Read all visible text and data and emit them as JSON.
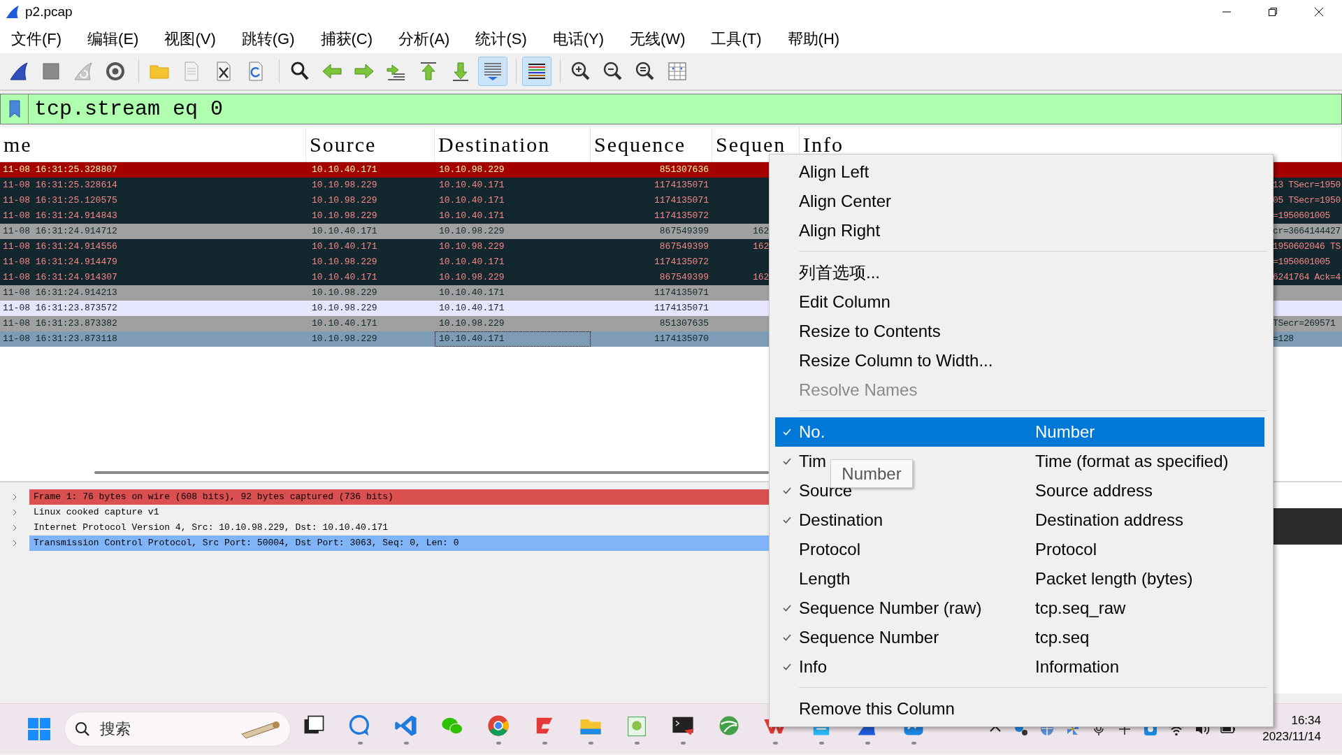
{
  "window": {
    "title": "p2.pcap"
  },
  "menu_bar": [
    "文件(F)",
    "编辑(E)",
    "视图(V)",
    "跳转(G)",
    "捕获(C)",
    "分析(A)",
    "统计(S)",
    "电话(Y)",
    "无线(W)",
    "工具(T)",
    "帮助(H)"
  ],
  "toolbar": [
    [
      {
        "kind": "start",
        "on": false
      },
      {
        "kind": "stop",
        "on": false
      },
      {
        "kind": "restart",
        "on": false
      },
      {
        "kind": "options",
        "on": false
      }
    ],
    [
      {
        "kind": "open",
        "on": false
      },
      {
        "kind": "save",
        "on": false
      },
      {
        "kind": "close",
        "on": false
      },
      {
        "kind": "reload",
        "on": false
      }
    ],
    [
      {
        "kind": "find",
        "on": false
      },
      {
        "kind": "back",
        "on": false
      },
      {
        "kind": "forward",
        "on": false
      },
      {
        "kind": "goto",
        "on": false
      },
      {
        "kind": "first",
        "on": false
      },
      {
        "kind": "last",
        "on": false
      },
      {
        "kind": "autoscroll",
        "on": true
      }
    ],
    [
      {
        "kind": "colorize",
        "on": true
      }
    ],
    [
      {
        "kind": "zoomin",
        "on": false
      },
      {
        "kind": "zoomout",
        "on": false
      },
      {
        "kind": "zoomreset",
        "on": false
      },
      {
        "kind": "resize",
        "on": false
      }
    ]
  ],
  "filter": {
    "value": "tcp.stream eq 0"
  },
  "packet_list": {
    "columns": [
      "me",
      "Source",
      "Destination",
      "Sequence",
      "Sequen",
      "Info"
    ],
    "rows": [
      {
        "kind": "error",
        "selected": false,
        "time": "11-08 16:31:25.328807",
        "source": "10.10.40.171",
        "destination": "10.10.98.229",
        "sequence": "851307636"
      },
      {
        "kind": "bad",
        "selected": false,
        "time": "11-08 16:31:25.328614",
        "source": "10.10.98.229",
        "destination": "10.10.40.171",
        "sequence": "1174135071",
        "info": "13 TSecr=1950"
      },
      {
        "kind": "bad",
        "selected": false,
        "time": "11-08 16:31:25.120575",
        "source": "10.10.98.229",
        "destination": "10.10.40.171",
        "sequence": "1174135071",
        "info": "05 TSecr=1950"
      },
      {
        "kind": "bad",
        "selected": false,
        "time": "11-08 16:31:24.914843",
        "source": "10.10.98.229",
        "destination": "10.10.40.171",
        "sequence": "1174135072",
        "info": "=1950601005"
      },
      {
        "kind": "gray",
        "selected": false,
        "time": "11-08 16:31:24.914712",
        "source": "10.10.40.171",
        "destination": "10.10.98.229",
        "sequence": "867549399",
        "column_5": "162",
        "info": "cr=3664144427"
      },
      {
        "kind": "bad",
        "selected": false,
        "time": "11-08 16:31:24.914556",
        "source": "10.10.40.171",
        "destination": "10.10.98.229",
        "sequence": "867549399",
        "column_5": "162",
        "info": "1950602046 TS"
      },
      {
        "kind": "bad",
        "selected": false,
        "time": "11-08 16:31:24.914479",
        "source": "10.10.98.229",
        "destination": "10.10.40.171",
        "sequence": "1174135072",
        "info": "=1950601005"
      },
      {
        "kind": "bad",
        "selected": false,
        "time": "11-08 16:31:24.914307",
        "source": "10.10.40.171",
        "destination": "10.10.98.229",
        "sequence": "867549399",
        "column_5": "162",
        "info": "6241764 Ack=4"
      },
      {
        "kind": "gray",
        "selected": false,
        "time": "11-08 16:31:24.914213",
        "source": "10.10.98.229",
        "destination": "10.10.40.171",
        "sequence": "1174135071"
      },
      {
        "kind": "tcp",
        "selected": false,
        "time": "11-08 16:31:23.873572",
        "source": "10.10.98.229",
        "destination": "10.10.40.171",
        "sequence": "1174135071"
      },
      {
        "kind": "gray",
        "selected": false,
        "time": "11-08 16:31:23.873382",
        "source": "10.10.40.171",
        "destination": "10.10.98.229",
        "sequence": "851307635",
        "info": "TSecr=269571"
      },
      {
        "kind": "tcp",
        "selected": true,
        "time": "11-08 16:31:23.873118",
        "source": "10.10.98.229",
        "destination": "10.10.40.171",
        "sequence": "1174135070",
        "info": "=128"
      }
    ]
  },
  "packet_details": [
    {
      "kind": "error",
      "selected": false,
      "expanded": false,
      "text": "Frame 1: 76 bytes on wire (608 bits), 92 bytes captured (736 bits)"
    },
    {
      "kind": "plain",
      "selected": false,
      "expanded": false,
      "text": "Linux cooked capture v1"
    },
    {
      "kind": "plain",
      "selected": false,
      "expanded": false,
      "text": "Internet Protocol Version 4, Src: 10.10.98.229, Dst: 10.10.40.171"
    },
    {
      "kind": "plain",
      "selected": true,
      "expanded": false,
      "text": "Transmission Control Protocol, Src Port: 50004, Dst Port: 3063, Seq: 0, Len: 0"
    }
  ],
  "context_menu": {
    "items": [
      {
        "kind": "action",
        "label": "Align Left",
        "disabled": false,
        "selected": false
      },
      {
        "kind": "action",
        "label": "Align Center",
        "disabled": false,
        "selected": false
      },
      {
        "kind": "action",
        "label": "Align Right",
        "disabled": false,
        "selected": false
      },
      {
        "kind": "separator"
      },
      {
        "kind": "action",
        "label": "列首选项...",
        "disabled": false,
        "selected": false
      },
      {
        "kind": "action",
        "label": "Edit Column",
        "disabled": false,
        "selected": false
      },
      {
        "kind": "action",
        "label": "Resize to Contents",
        "disabled": false,
        "selected": false
      },
      {
        "kind": "action",
        "label": "Resize Column to Width...",
        "disabled": false,
        "selected": false
      },
      {
        "kind": "action",
        "label": "Resolve Names",
        "disabled": true,
        "selected": false
      },
      {
        "kind": "separator"
      },
      {
        "kind": "column",
        "label": "No.",
        "description": "Number",
        "checked": true,
        "selected": true
      },
      {
        "kind": "column",
        "label": "Tim",
        "description": "Time (format as specified)",
        "checked": true,
        "selected": false
      },
      {
        "kind": "column",
        "label": "Source",
        "description": "Source address",
        "checked": true,
        "selected": false
      },
      {
        "kind": "column",
        "label": "Destination",
        "description": "Destination address",
        "checked": true,
        "selected": false
      },
      {
        "kind": "column",
        "label": "Protocol",
        "description": "Protocol",
        "checked": false,
        "selected": false
      },
      {
        "kind": "column",
        "label": "Length",
        "description": "Packet length (bytes)",
        "checked": false,
        "selected": false
      },
      {
        "kind": "column",
        "label": "Sequence Number (raw)",
        "description": "tcp.seq_raw",
        "checked": true,
        "selected": false
      },
      {
        "kind": "column",
        "label": "Sequence Number",
        "description": "tcp.seq",
        "checked": true,
        "selected": false
      },
      {
        "kind": "column",
        "label": "Info",
        "description": "Information",
        "checked": true,
        "selected": false
      },
      {
        "kind": "separator"
      },
      {
        "kind": "action",
        "label": "Remove this Column",
        "disabled": false,
        "selected": false
      }
    ]
  },
  "tooltip": {
    "text": "Number"
  },
  "taskbar": {
    "search": {
      "placeholder": "搜索"
    },
    "apps": [
      {
        "kind": "taskview",
        "running": false
      },
      {
        "kind": "chat",
        "running": true
      },
      {
        "kind": "vscode",
        "running": true
      },
      {
        "kind": "wechat",
        "running": false
      },
      {
        "kind": "chrome",
        "running": true
      },
      {
        "kind": "redapp",
        "running": true
      },
      {
        "kind": "files",
        "running": true
      },
      {
        "kind": "notepad",
        "running": true
      },
      {
        "kind": "terminal",
        "running": true
      },
      {
        "kind": "globe",
        "running": false
      },
      {
        "kind": "wps",
        "running": true
      },
      {
        "kind": "notes",
        "running": true
      },
      {
        "kind": "wireshark",
        "running": true
      },
      {
        "kind": "blueapp",
        "running": true
      }
    ],
    "tray": [
      {
        "kind": "chevron"
      },
      {
        "kind": "dots"
      },
      {
        "kind": "globe"
      },
      {
        "kind": "pinwheel"
      },
      {
        "kind": "mic"
      },
      {
        "kind": "keyboard"
      },
      {
        "kind": "bluesquare"
      },
      {
        "kind": "wifi"
      },
      {
        "kind": "speaker"
      },
      {
        "kind": "battery"
      }
    ],
    "clock": {
      "time": "16:34",
      "date": "2023/11/14"
    }
  }
}
